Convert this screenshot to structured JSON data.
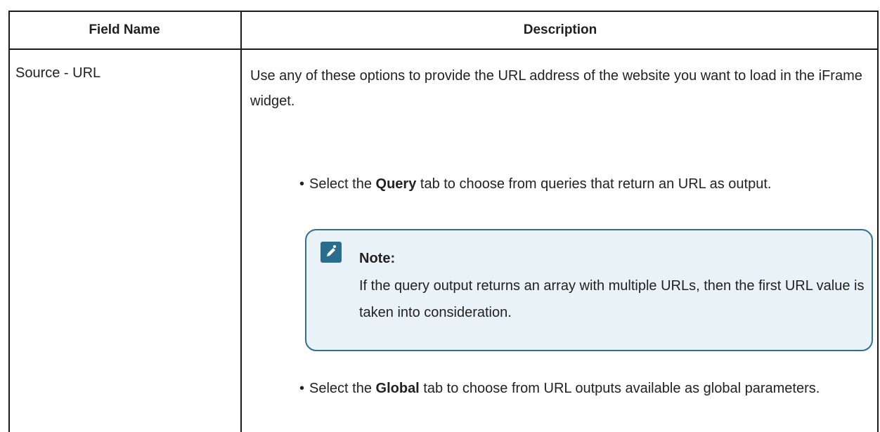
{
  "table": {
    "headers": [
      "Field Name",
      "Description"
    ],
    "rows": [
      {
        "field": "Source - URL",
        "description": "Use any of these options to provide the URL address of the website you want to load in the iFrame widget.",
        "bullets": [
          {
            "pre": "Select the ",
            "bold": "Query",
            "post": " tab to choose from queries that return an URL as output."
          },
          {
            "pre": "Select the ",
            "bold": "Global",
            "post": " tab to choose from URL outputs available as global parameters."
          }
        ],
        "note": {
          "icon": "pencil-note-icon",
          "title": "Note:",
          "text": "If the query output returns an array with multiple URLs, then the first URL value is taken into consideration."
        }
      }
    ]
  },
  "colors": {
    "border": "#1a1a1a",
    "note_border": "#2f6f8f",
    "note_bg": "#e9f2f7",
    "icon_bg": "#2b6d8d"
  }
}
